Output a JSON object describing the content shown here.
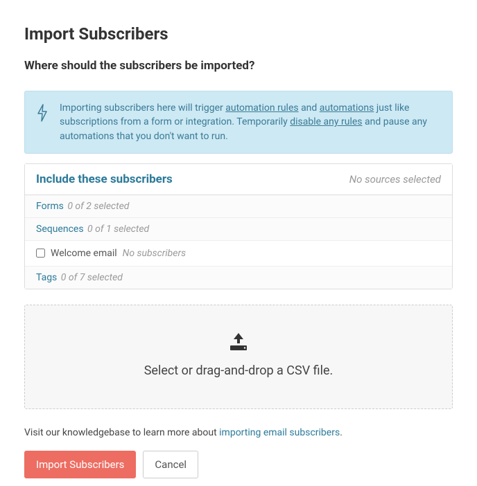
{
  "page": {
    "title": "Import Subscribers",
    "subtitle": "Where should the subscribers be imported?"
  },
  "banner": {
    "prefix": "Importing subscribers here will trigger ",
    "link1": "automation rules",
    "mid1": " and ",
    "link2": "automations",
    "mid2": " just like subscriptions from a form or integration. Temporarily ",
    "link3": "disable any rules",
    "suffix": " and pause any automations that you don't want to run."
  },
  "panel": {
    "title": "Include these subscribers",
    "status": "No sources selected",
    "forms": {
      "label": "Forms",
      "counter": "0 of 2 selected"
    },
    "sequences": {
      "label": "Sequences",
      "counter": "0 of 1 selected",
      "items": [
        {
          "label": "Welcome email",
          "meta": "No subscribers",
          "checked": false
        }
      ]
    },
    "tags": {
      "label": "Tags",
      "counter": "0 of 7 selected"
    }
  },
  "dropzone": {
    "label": "Select or drag-and-drop a CSV file."
  },
  "footnote": {
    "prefix": "Visit our knowledgebase to learn more about ",
    "link": "importing email subscribers",
    "suffix": "."
  },
  "buttons": {
    "primary": "Import Subscribers",
    "secondary": "Cancel"
  }
}
